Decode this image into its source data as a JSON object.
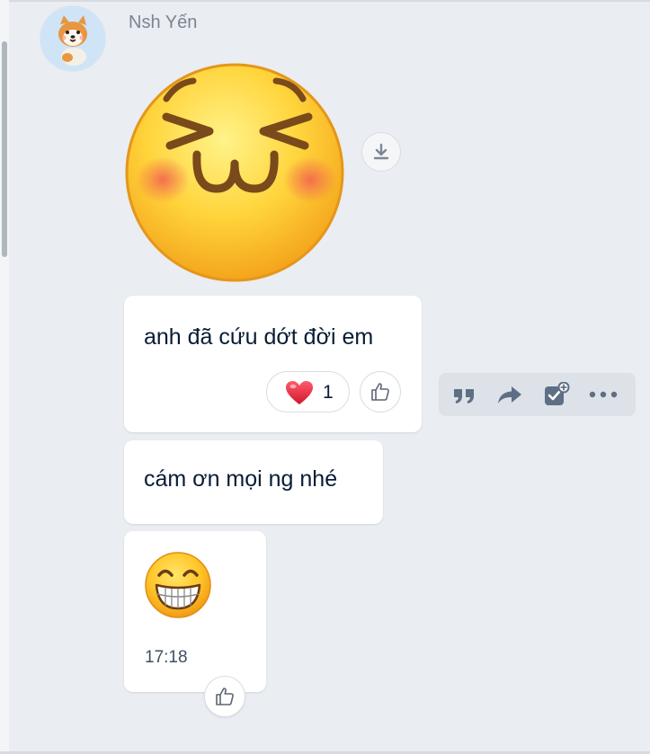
{
  "conversation": {
    "sender_name": "Nsh Yến",
    "avatar_icon": "shiba-dog-avatar",
    "sticker_icon": "laughing-squint-face-sticker",
    "messages": [
      {
        "text": "anh đã cứu dớt đời em"
      },
      {
        "text": "cám ơn mọi ng nhé"
      },
      {
        "emoji_icon": "grinning-face-emoji",
        "time": "17:18"
      }
    ],
    "reaction": {
      "icon": "heart-icon",
      "count": "1"
    }
  },
  "actions": {
    "items": [
      "quote-icon",
      "forward-icon",
      "add-todo-icon",
      "more-icon"
    ]
  },
  "colors": {
    "background": "#eaedf1",
    "bubble": "#ffffff",
    "text": "#081c36",
    "sender": "#7a8593",
    "accent_icon": "#5e6f85",
    "heart": "#e8283b"
  }
}
